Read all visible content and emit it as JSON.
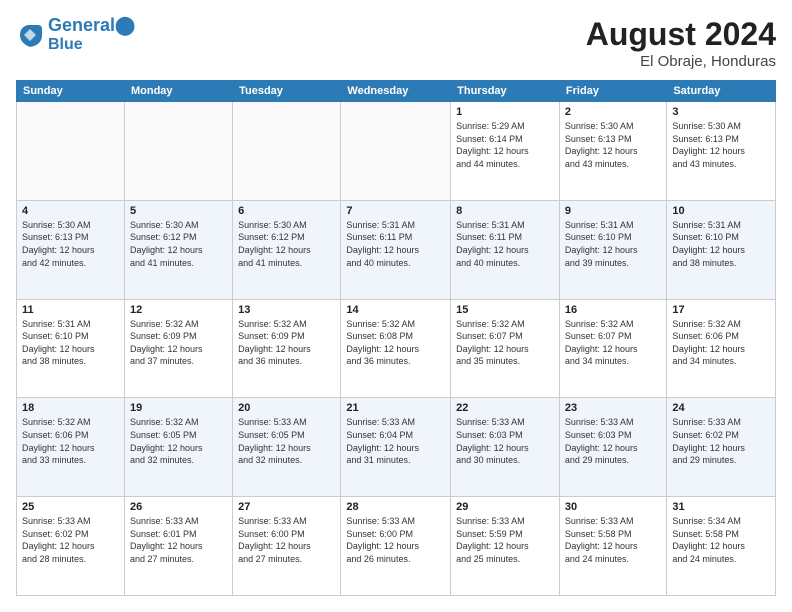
{
  "header": {
    "logo_line1": "General",
    "logo_line2": "Blue",
    "month_title": "August 2024",
    "location": "El Obraje, Honduras"
  },
  "weekdays": [
    "Sunday",
    "Monday",
    "Tuesday",
    "Wednesday",
    "Thursday",
    "Friday",
    "Saturday"
  ],
  "weeks": [
    [
      {
        "day": "",
        "info": ""
      },
      {
        "day": "",
        "info": ""
      },
      {
        "day": "",
        "info": ""
      },
      {
        "day": "",
        "info": ""
      },
      {
        "day": "1",
        "info": "Sunrise: 5:29 AM\nSunset: 6:14 PM\nDaylight: 12 hours\nand 44 minutes."
      },
      {
        "day": "2",
        "info": "Sunrise: 5:30 AM\nSunset: 6:13 PM\nDaylight: 12 hours\nand 43 minutes."
      },
      {
        "day": "3",
        "info": "Sunrise: 5:30 AM\nSunset: 6:13 PM\nDaylight: 12 hours\nand 43 minutes."
      }
    ],
    [
      {
        "day": "4",
        "info": "Sunrise: 5:30 AM\nSunset: 6:13 PM\nDaylight: 12 hours\nand 42 minutes."
      },
      {
        "day": "5",
        "info": "Sunrise: 5:30 AM\nSunset: 6:12 PM\nDaylight: 12 hours\nand 41 minutes."
      },
      {
        "day": "6",
        "info": "Sunrise: 5:30 AM\nSunset: 6:12 PM\nDaylight: 12 hours\nand 41 minutes."
      },
      {
        "day": "7",
        "info": "Sunrise: 5:31 AM\nSunset: 6:11 PM\nDaylight: 12 hours\nand 40 minutes."
      },
      {
        "day": "8",
        "info": "Sunrise: 5:31 AM\nSunset: 6:11 PM\nDaylight: 12 hours\nand 40 minutes."
      },
      {
        "day": "9",
        "info": "Sunrise: 5:31 AM\nSunset: 6:10 PM\nDaylight: 12 hours\nand 39 minutes."
      },
      {
        "day": "10",
        "info": "Sunrise: 5:31 AM\nSunset: 6:10 PM\nDaylight: 12 hours\nand 38 minutes."
      }
    ],
    [
      {
        "day": "11",
        "info": "Sunrise: 5:31 AM\nSunset: 6:10 PM\nDaylight: 12 hours\nand 38 minutes."
      },
      {
        "day": "12",
        "info": "Sunrise: 5:32 AM\nSunset: 6:09 PM\nDaylight: 12 hours\nand 37 minutes."
      },
      {
        "day": "13",
        "info": "Sunrise: 5:32 AM\nSunset: 6:09 PM\nDaylight: 12 hours\nand 36 minutes."
      },
      {
        "day": "14",
        "info": "Sunrise: 5:32 AM\nSunset: 6:08 PM\nDaylight: 12 hours\nand 36 minutes."
      },
      {
        "day": "15",
        "info": "Sunrise: 5:32 AM\nSunset: 6:07 PM\nDaylight: 12 hours\nand 35 minutes."
      },
      {
        "day": "16",
        "info": "Sunrise: 5:32 AM\nSunset: 6:07 PM\nDaylight: 12 hours\nand 34 minutes."
      },
      {
        "day": "17",
        "info": "Sunrise: 5:32 AM\nSunset: 6:06 PM\nDaylight: 12 hours\nand 34 minutes."
      }
    ],
    [
      {
        "day": "18",
        "info": "Sunrise: 5:32 AM\nSunset: 6:06 PM\nDaylight: 12 hours\nand 33 minutes."
      },
      {
        "day": "19",
        "info": "Sunrise: 5:32 AM\nSunset: 6:05 PM\nDaylight: 12 hours\nand 32 minutes."
      },
      {
        "day": "20",
        "info": "Sunrise: 5:33 AM\nSunset: 6:05 PM\nDaylight: 12 hours\nand 32 minutes."
      },
      {
        "day": "21",
        "info": "Sunrise: 5:33 AM\nSunset: 6:04 PM\nDaylight: 12 hours\nand 31 minutes."
      },
      {
        "day": "22",
        "info": "Sunrise: 5:33 AM\nSunset: 6:03 PM\nDaylight: 12 hours\nand 30 minutes."
      },
      {
        "day": "23",
        "info": "Sunrise: 5:33 AM\nSunset: 6:03 PM\nDaylight: 12 hours\nand 29 minutes."
      },
      {
        "day": "24",
        "info": "Sunrise: 5:33 AM\nSunset: 6:02 PM\nDaylight: 12 hours\nand 29 minutes."
      }
    ],
    [
      {
        "day": "25",
        "info": "Sunrise: 5:33 AM\nSunset: 6:02 PM\nDaylight: 12 hours\nand 28 minutes."
      },
      {
        "day": "26",
        "info": "Sunrise: 5:33 AM\nSunset: 6:01 PM\nDaylight: 12 hours\nand 27 minutes."
      },
      {
        "day": "27",
        "info": "Sunrise: 5:33 AM\nSunset: 6:00 PM\nDaylight: 12 hours\nand 27 minutes."
      },
      {
        "day": "28",
        "info": "Sunrise: 5:33 AM\nSunset: 6:00 PM\nDaylight: 12 hours\nand 26 minutes."
      },
      {
        "day": "29",
        "info": "Sunrise: 5:33 AM\nSunset: 5:59 PM\nDaylight: 12 hours\nand 25 minutes."
      },
      {
        "day": "30",
        "info": "Sunrise: 5:33 AM\nSunset: 5:58 PM\nDaylight: 12 hours\nand 24 minutes."
      },
      {
        "day": "31",
        "info": "Sunrise: 5:34 AM\nSunset: 5:58 PM\nDaylight: 12 hours\nand 24 minutes."
      }
    ]
  ]
}
